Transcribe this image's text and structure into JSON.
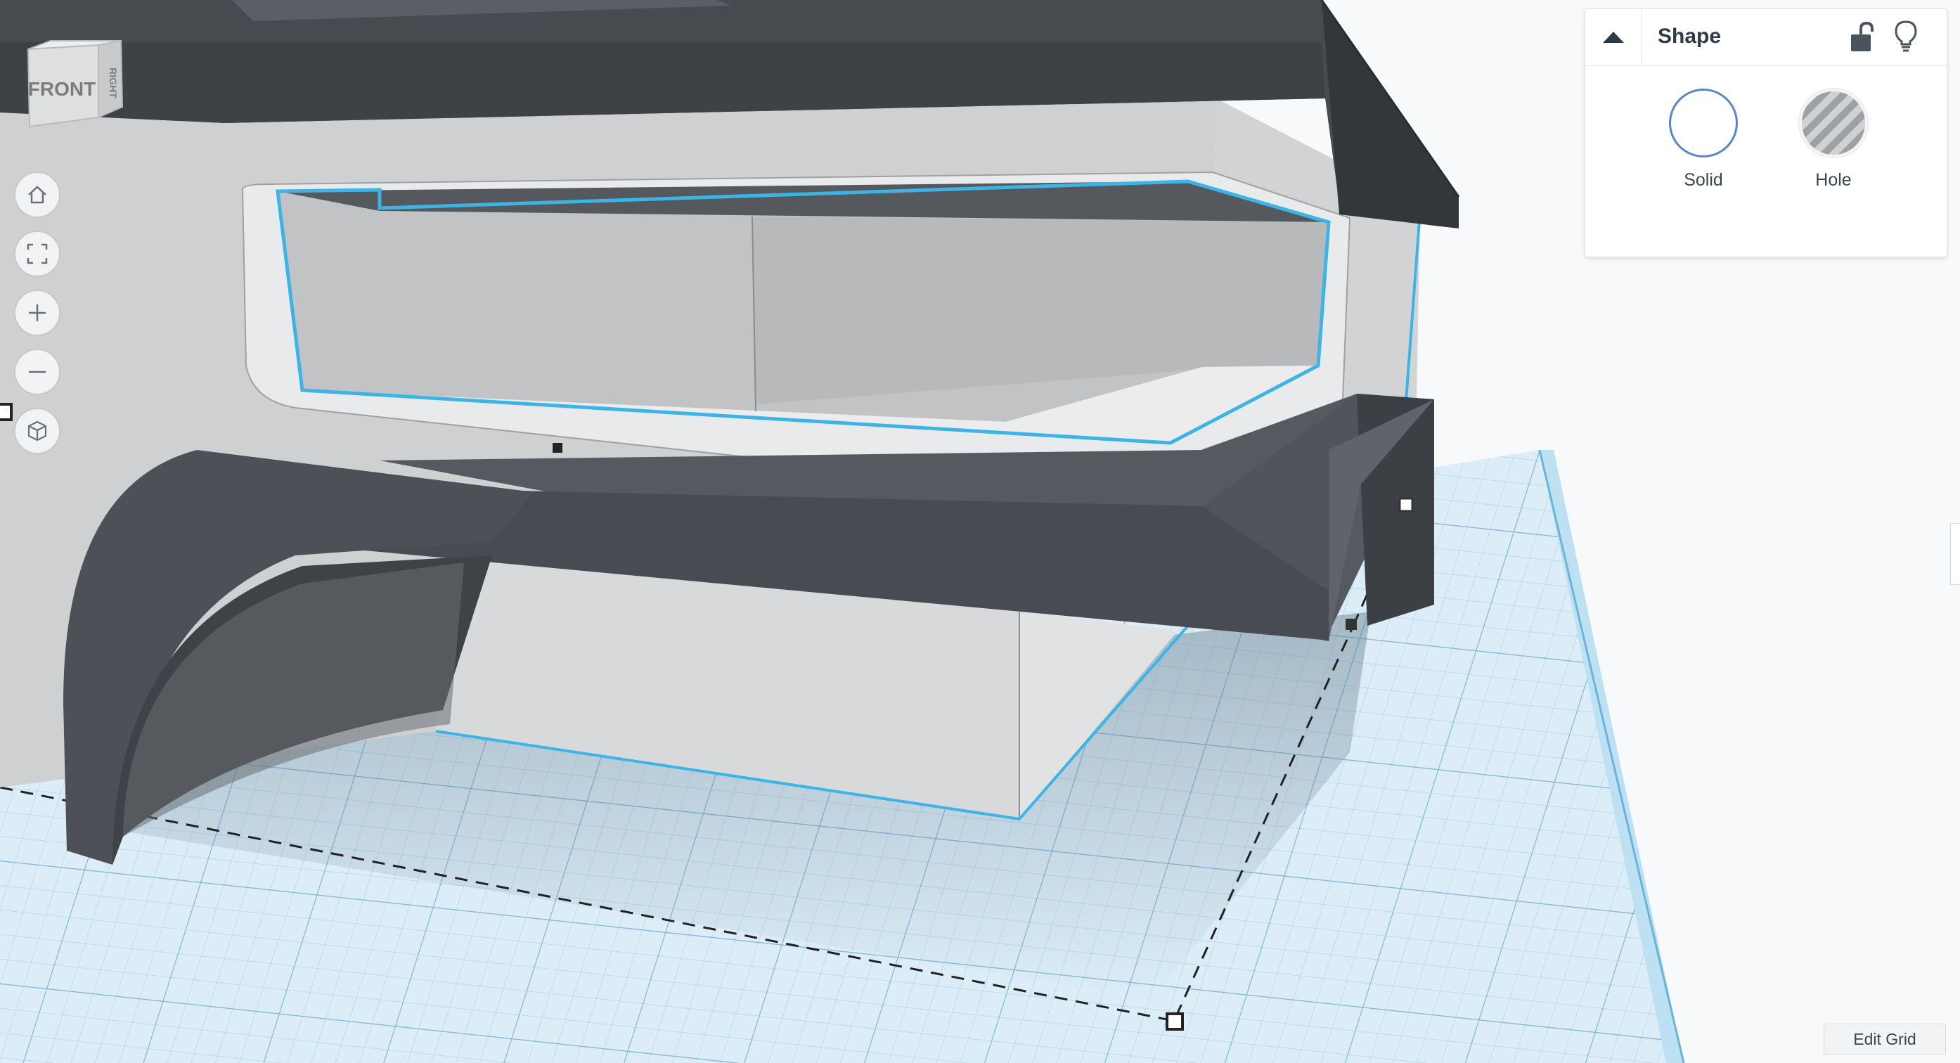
{
  "viewcube": {
    "front_label": "FRONT",
    "side_label": "RIGHT"
  },
  "nav_controls": [
    {
      "name": "home-view",
      "icon": "home-icon"
    },
    {
      "name": "fit-all",
      "icon": "fit-view-icon"
    },
    {
      "name": "zoom-in",
      "icon": "plus-icon"
    },
    {
      "name": "zoom-out",
      "icon": "minus-icon"
    },
    {
      "name": "perspective",
      "icon": "cube-icon"
    }
  ],
  "inspector": {
    "title": "Shape",
    "collapse_icon": "triangle-up-icon",
    "lock_icon": "unlock-icon",
    "visibility_icon": "lightbulb-icon",
    "options": [
      {
        "label": "Solid",
        "selected": true
      },
      {
        "label": "Hole",
        "selected": false
      }
    ]
  },
  "footer": {
    "edit_grid_label": "Edit Grid"
  },
  "colors": {
    "grid_fill": "#d7eaf5",
    "grid_line": "#9fc8e0",
    "selection_outline": "#3db4e6",
    "dark_shape": "#4a4f55",
    "light_shape": "#d3d4d5",
    "accent": "#5b86c5"
  }
}
